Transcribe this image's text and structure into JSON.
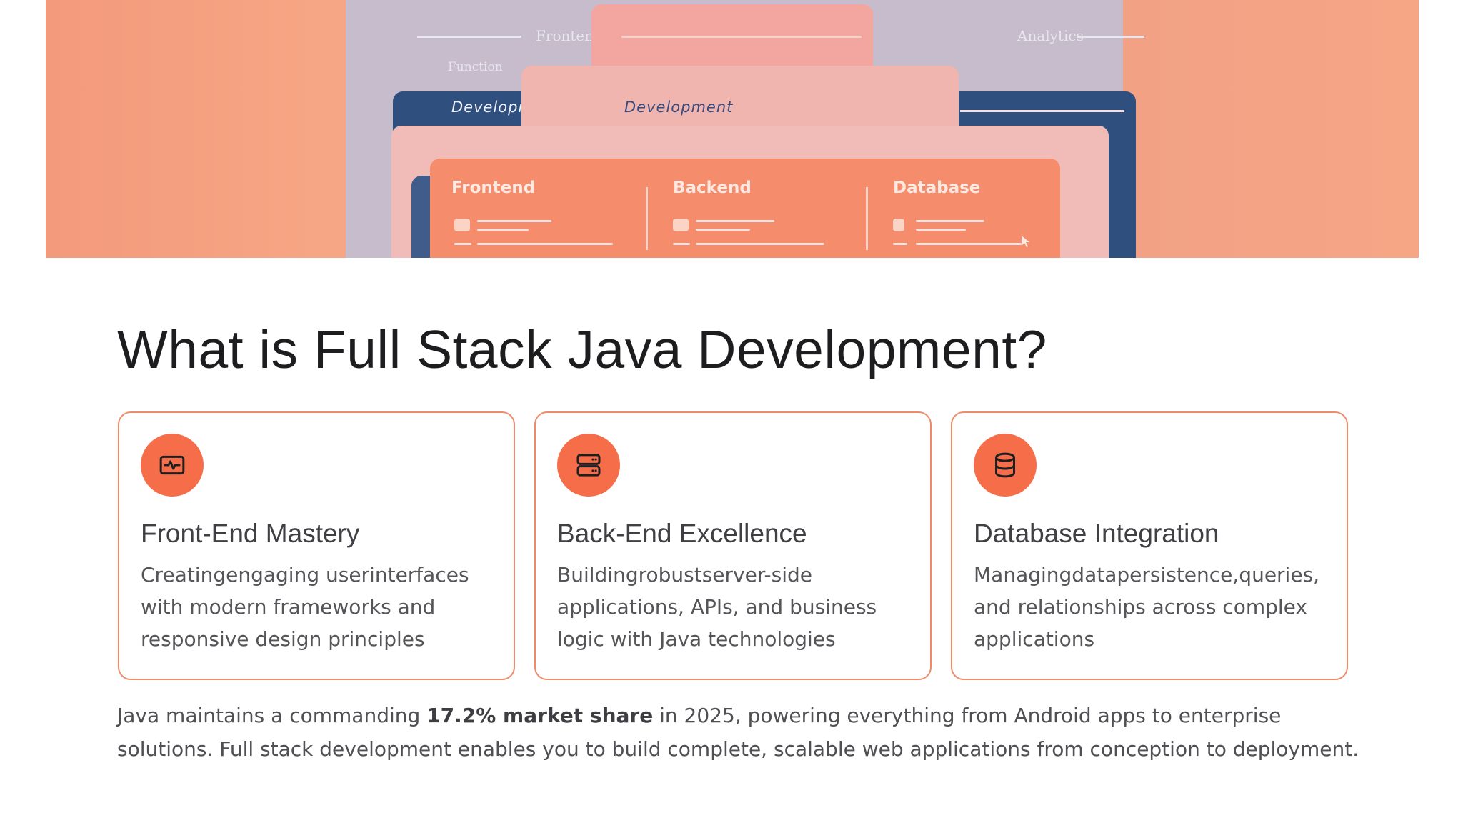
{
  "hero": {
    "labels": {
      "frontend_top": "Frontend",
      "function": "Function",
      "analytics": "Analytics",
      "dev_left": "Developmentension",
      "dev_right": "Development",
      "col_frontend": "Frontend",
      "col_backend": "Backend",
      "col_database": "Database"
    }
  },
  "main": {
    "title": "What is Full Stack Java Development?",
    "features": [
      {
        "icon": "activity-monitor-icon",
        "title": "Front-End Mastery",
        "description": "Creatingengaging userinterfaces with modern frameworks and responsive design principles"
      },
      {
        "icon": "server-icon",
        "title": "Back-End Excellence",
        "description": "Buildingrobustserver-side applications, APIs, and business logic with Java technologies"
      },
      {
        "icon": "database-icon",
        "title": "Database Integration",
        "description": "Managingdatapersistence,queries, and relationships across complex applications"
      }
    ],
    "paragraph": {
      "before": "Java maintains a commanding ",
      "highlight": "17.2% market share",
      "after": " in 2025, powering everything from Android apps to enterprise solutions. Full stack development enables you to build complete, scalable web applications from conception to deployment."
    }
  },
  "colors": {
    "accent": "#f56e49",
    "card_border": "#ef8a6a",
    "hero_bg": "#f6a684"
  }
}
